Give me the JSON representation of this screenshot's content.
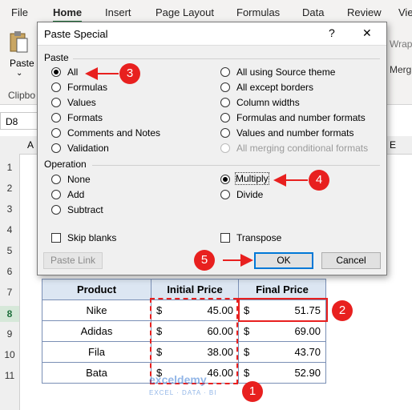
{
  "ribbon": {
    "tabs": [
      "File",
      "Home",
      "Insert",
      "Page Layout",
      "Formulas",
      "Data",
      "Review",
      "Vie"
    ],
    "paste_label": "Paste",
    "clipboard_label": "Clipbo",
    "wrap_label": "Wrap",
    "merge_label": "Merg"
  },
  "name_box": "D8",
  "col_headers": [
    "A",
    "E"
  ],
  "rows": [
    "1",
    "2",
    "3",
    "4",
    "5",
    "6",
    "7",
    "8",
    "9",
    "10",
    "11"
  ],
  "table": {
    "headers": [
      "Product",
      "Initial Price",
      "Final Price"
    ],
    "currency": "$",
    "rows": [
      {
        "product": "Nike",
        "initial": "45.00",
        "final": "51.75"
      },
      {
        "product": "Adidas",
        "initial": "60.00",
        "final": "69.00"
      },
      {
        "product": "Fila",
        "initial": "38.00",
        "final": "43.70"
      },
      {
        "product": "Bata",
        "initial": "46.00",
        "final": "52.90"
      }
    ]
  },
  "dialog": {
    "title": "Paste Special",
    "help": "?",
    "close": "✕",
    "paste_section": "Paste",
    "paste_options": [
      "All",
      "Formulas",
      "Values",
      "Formats",
      "Comments and Notes",
      "Validation",
      "All using Source theme",
      "All except borders",
      "Column widths",
      "Formulas and number formats",
      "Values and number formats",
      "All merging conditional formats"
    ],
    "operation_section": "Operation",
    "operation_options": [
      "None",
      "Add",
      "Subtract",
      "Multiply",
      "Divide"
    ],
    "skip_blanks": "Skip blanks",
    "transpose": "Transpose",
    "paste_link": "Paste Link",
    "ok": "OK",
    "cancel": "Cancel"
  },
  "callouts": [
    "1",
    "2",
    "3",
    "4",
    "5"
  ],
  "watermark": {
    "name": "exceldemy",
    "tagline": "EXCEL · DATA · BI"
  },
  "colors": {
    "accent": "#e8201f",
    "excel_green": "#1e6f3b",
    "header_fill": "#dce6f2"
  }
}
